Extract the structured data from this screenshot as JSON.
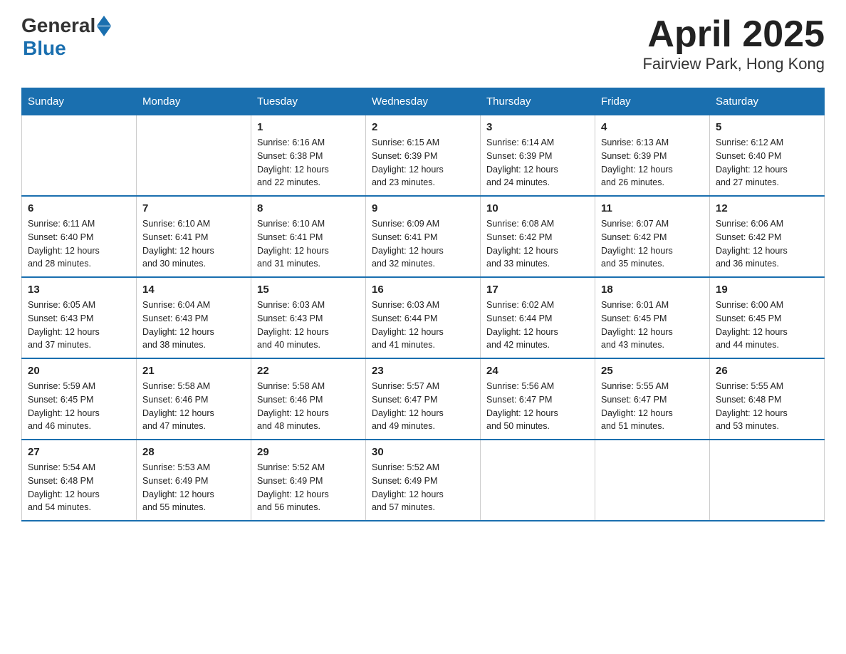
{
  "header": {
    "logo_general": "General",
    "logo_blue": "Blue",
    "title": "April 2025",
    "location": "Fairview Park, Hong Kong"
  },
  "days_of_week": [
    "Sunday",
    "Monday",
    "Tuesday",
    "Wednesday",
    "Thursday",
    "Friday",
    "Saturday"
  ],
  "weeks": [
    [
      {
        "day": "",
        "info": ""
      },
      {
        "day": "",
        "info": ""
      },
      {
        "day": "1",
        "info": "Sunrise: 6:16 AM\nSunset: 6:38 PM\nDaylight: 12 hours\nand 22 minutes."
      },
      {
        "day": "2",
        "info": "Sunrise: 6:15 AM\nSunset: 6:39 PM\nDaylight: 12 hours\nand 23 minutes."
      },
      {
        "day": "3",
        "info": "Sunrise: 6:14 AM\nSunset: 6:39 PM\nDaylight: 12 hours\nand 24 minutes."
      },
      {
        "day": "4",
        "info": "Sunrise: 6:13 AM\nSunset: 6:39 PM\nDaylight: 12 hours\nand 26 minutes."
      },
      {
        "day": "5",
        "info": "Sunrise: 6:12 AM\nSunset: 6:40 PM\nDaylight: 12 hours\nand 27 minutes."
      }
    ],
    [
      {
        "day": "6",
        "info": "Sunrise: 6:11 AM\nSunset: 6:40 PM\nDaylight: 12 hours\nand 28 minutes."
      },
      {
        "day": "7",
        "info": "Sunrise: 6:10 AM\nSunset: 6:41 PM\nDaylight: 12 hours\nand 30 minutes."
      },
      {
        "day": "8",
        "info": "Sunrise: 6:10 AM\nSunset: 6:41 PM\nDaylight: 12 hours\nand 31 minutes."
      },
      {
        "day": "9",
        "info": "Sunrise: 6:09 AM\nSunset: 6:41 PM\nDaylight: 12 hours\nand 32 minutes."
      },
      {
        "day": "10",
        "info": "Sunrise: 6:08 AM\nSunset: 6:42 PM\nDaylight: 12 hours\nand 33 minutes."
      },
      {
        "day": "11",
        "info": "Sunrise: 6:07 AM\nSunset: 6:42 PM\nDaylight: 12 hours\nand 35 minutes."
      },
      {
        "day": "12",
        "info": "Sunrise: 6:06 AM\nSunset: 6:42 PM\nDaylight: 12 hours\nand 36 minutes."
      }
    ],
    [
      {
        "day": "13",
        "info": "Sunrise: 6:05 AM\nSunset: 6:43 PM\nDaylight: 12 hours\nand 37 minutes."
      },
      {
        "day": "14",
        "info": "Sunrise: 6:04 AM\nSunset: 6:43 PM\nDaylight: 12 hours\nand 38 minutes."
      },
      {
        "day": "15",
        "info": "Sunrise: 6:03 AM\nSunset: 6:43 PM\nDaylight: 12 hours\nand 40 minutes."
      },
      {
        "day": "16",
        "info": "Sunrise: 6:03 AM\nSunset: 6:44 PM\nDaylight: 12 hours\nand 41 minutes."
      },
      {
        "day": "17",
        "info": "Sunrise: 6:02 AM\nSunset: 6:44 PM\nDaylight: 12 hours\nand 42 minutes."
      },
      {
        "day": "18",
        "info": "Sunrise: 6:01 AM\nSunset: 6:45 PM\nDaylight: 12 hours\nand 43 minutes."
      },
      {
        "day": "19",
        "info": "Sunrise: 6:00 AM\nSunset: 6:45 PM\nDaylight: 12 hours\nand 44 minutes."
      }
    ],
    [
      {
        "day": "20",
        "info": "Sunrise: 5:59 AM\nSunset: 6:45 PM\nDaylight: 12 hours\nand 46 minutes."
      },
      {
        "day": "21",
        "info": "Sunrise: 5:58 AM\nSunset: 6:46 PM\nDaylight: 12 hours\nand 47 minutes."
      },
      {
        "day": "22",
        "info": "Sunrise: 5:58 AM\nSunset: 6:46 PM\nDaylight: 12 hours\nand 48 minutes."
      },
      {
        "day": "23",
        "info": "Sunrise: 5:57 AM\nSunset: 6:47 PM\nDaylight: 12 hours\nand 49 minutes."
      },
      {
        "day": "24",
        "info": "Sunrise: 5:56 AM\nSunset: 6:47 PM\nDaylight: 12 hours\nand 50 minutes."
      },
      {
        "day": "25",
        "info": "Sunrise: 5:55 AM\nSunset: 6:47 PM\nDaylight: 12 hours\nand 51 minutes."
      },
      {
        "day": "26",
        "info": "Sunrise: 5:55 AM\nSunset: 6:48 PM\nDaylight: 12 hours\nand 53 minutes."
      }
    ],
    [
      {
        "day": "27",
        "info": "Sunrise: 5:54 AM\nSunset: 6:48 PM\nDaylight: 12 hours\nand 54 minutes."
      },
      {
        "day": "28",
        "info": "Sunrise: 5:53 AM\nSunset: 6:49 PM\nDaylight: 12 hours\nand 55 minutes."
      },
      {
        "day": "29",
        "info": "Sunrise: 5:52 AM\nSunset: 6:49 PM\nDaylight: 12 hours\nand 56 minutes."
      },
      {
        "day": "30",
        "info": "Sunrise: 5:52 AM\nSunset: 6:49 PM\nDaylight: 12 hours\nand 57 minutes."
      },
      {
        "day": "",
        "info": ""
      },
      {
        "day": "",
        "info": ""
      },
      {
        "day": "",
        "info": ""
      }
    ]
  ]
}
